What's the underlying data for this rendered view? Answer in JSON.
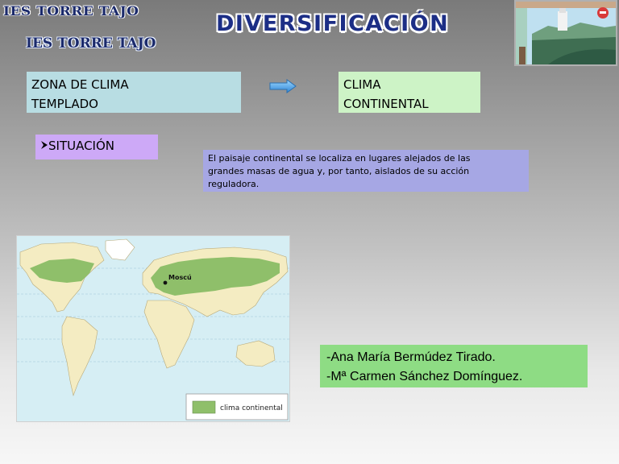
{
  "header": {
    "school_top": "IES TORRE TAJO",
    "school_logo": "IES TORRE TAJO",
    "title": "DIVERSIFICACIÓN"
  },
  "zona_box": {
    "line1": "ZONA DE CLIMA",
    "line2": "TEMPLADO"
  },
  "clima_box": {
    "line1": "CLIMA",
    "line2": "CONTINENTAL"
  },
  "arrow_icon": "right-arrow-icon",
  "situacion": {
    "bullet_icon": "arrow-bullet-icon",
    "label": "SITUACIÓN"
  },
  "description": {
    "line1": "El paisaje continental se localiza en lugares alejados de las",
    "line2": "grandes masas de agua y, por tanto, aislados de su acción",
    "line3": "reguladora."
  },
  "map": {
    "city_label": "Moscú",
    "legend_label": "clima continental",
    "continental_color": "#8fbf6a",
    "land_color": "#f4ecc2",
    "ocean_color": "#d6eef4"
  },
  "authors": {
    "line1": "-Ana María Bermúdez Tirado.",
    "line2": "-Mª Carmen Sánchez Domínguez."
  },
  "colors": {
    "zona_bg": "#b8dde3",
    "clima_bg": "#cdf3c6",
    "situacion_bg": "#cda9f7",
    "description_bg": "#a6a7e4",
    "authors_bg": "#8edc84",
    "title_color": "#1c2e86"
  }
}
